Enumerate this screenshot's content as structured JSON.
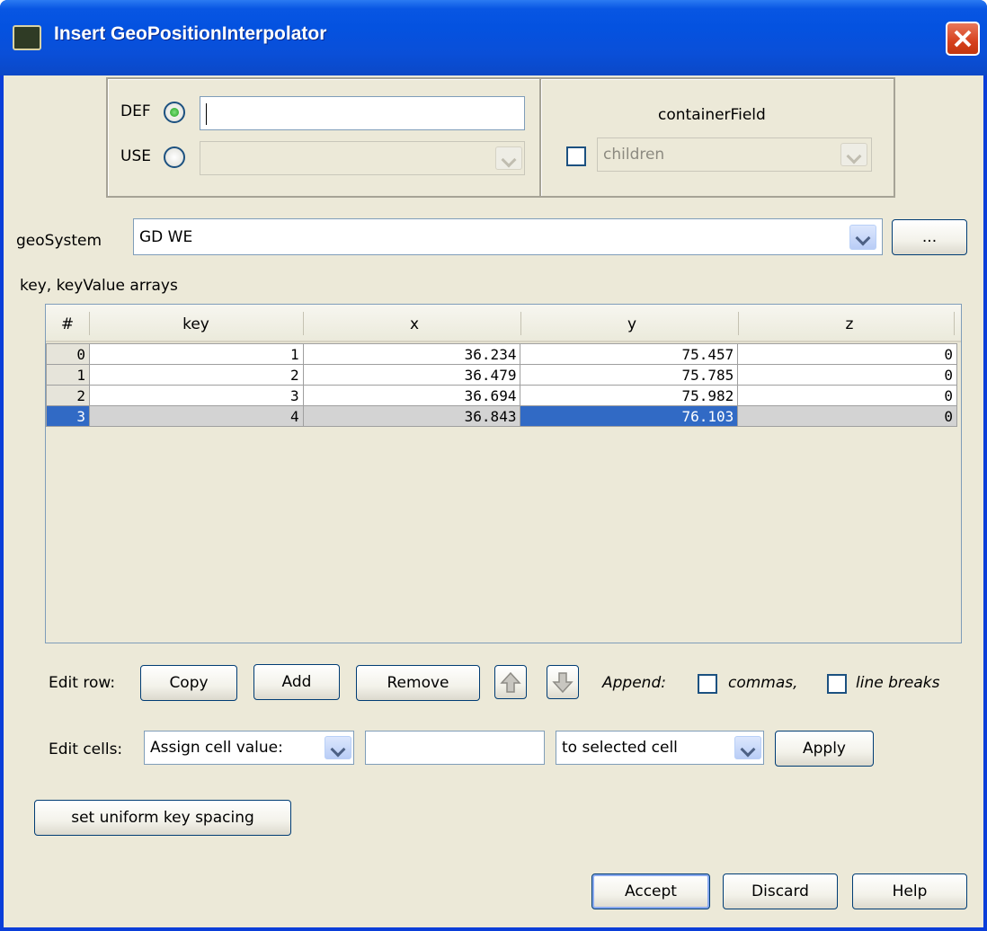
{
  "window": {
    "title": "Insert GeoPositionInterpolator"
  },
  "node": {
    "def_label": "DEF",
    "use_label": "USE",
    "def_value": "",
    "use_value": "",
    "container_field_label": "containerField",
    "container_field_value": "children"
  },
  "geo": {
    "label": "geoSystem",
    "value": "GD WE",
    "more_label": "..."
  },
  "arrays": {
    "section_label": "key, keyValue arrays",
    "columns": [
      "#",
      "key",
      "x",
      "y",
      "z"
    ],
    "rows": [
      [
        "0",
        "1",
        "36.234",
        "75.457",
        "0"
      ],
      [
        "1",
        "2",
        "36.479",
        "75.785",
        "0"
      ],
      [
        "2",
        "3",
        "36.694",
        "75.982",
        "0"
      ],
      [
        "3",
        "4",
        "36.843",
        "76.103",
        "0"
      ]
    ],
    "selected_row": 3
  },
  "edit_row": {
    "label": "Edit row:",
    "copy": "Copy",
    "add": "Add",
    "remove": "Remove",
    "append_label": "Append:",
    "commas": "commas,",
    "line_breaks": "line breaks"
  },
  "edit_cells": {
    "label": "Edit cells:",
    "mode": "Assign cell value:",
    "value": "",
    "target": "to selected cell",
    "apply": "Apply"
  },
  "uniform_button": "set uniform key spacing",
  "footer": {
    "accept": "Accept",
    "discard": "Discard",
    "help": "Help"
  }
}
